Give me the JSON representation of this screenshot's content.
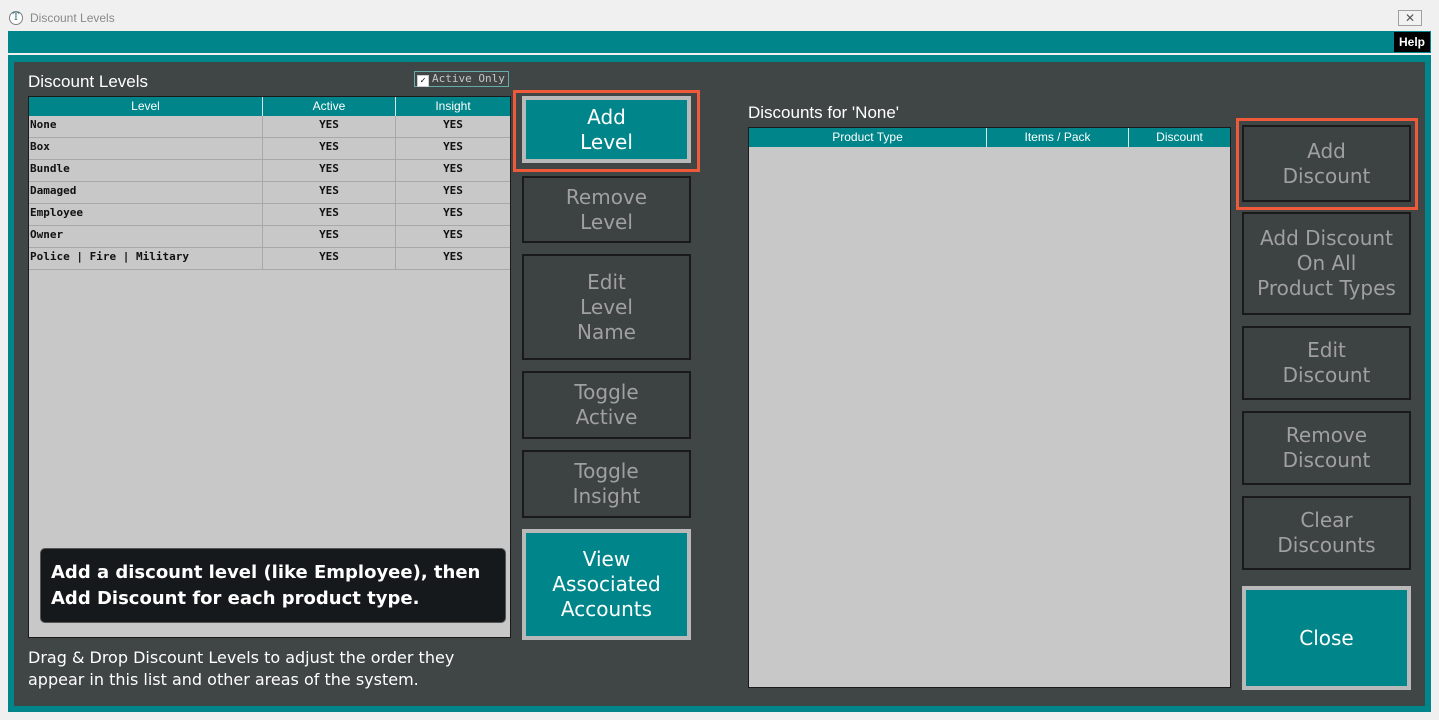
{
  "window": {
    "title": "Discount Levels",
    "close_glyph": "✕",
    "app_glyph": "T"
  },
  "menubar": {
    "help_label": "Help"
  },
  "levels": {
    "title": "Discount Levels",
    "active_only_label": "Active Only",
    "active_only_checked": true,
    "columns": [
      "Level",
      "Active",
      "Insight"
    ],
    "rows": [
      {
        "name": "None",
        "active": "YES",
        "insight": "YES"
      },
      {
        "name": "Box",
        "active": "YES",
        "insight": "YES"
      },
      {
        "name": "Bundle",
        "active": "YES",
        "insight": "YES"
      },
      {
        "name": "Damaged",
        "active": "YES",
        "insight": "YES"
      },
      {
        "name": "Employee",
        "active": "YES",
        "insight": "YES"
      },
      {
        "name": "Owner",
        "active": "YES",
        "insight": "YES"
      },
      {
        "name": "Police | Fire | Military",
        "active": "YES",
        "insight": "YES"
      }
    ]
  },
  "level_buttons": {
    "add": "Add\nLevel",
    "remove": "Remove\nLevel",
    "edit": "Edit\nLevel\nName",
    "toggle_active": "Toggle\nActive",
    "toggle_insight": "Toggle\nInsight",
    "view_accounts": "View\nAssociated\nAccounts"
  },
  "tooltip": "Add a discount level (like Employee), then Add Discount for each product type.",
  "drag_note": "Drag & Drop Discount Levels to adjust the order they appear in this list and other areas of the system.",
  "discounts": {
    "title": "Discounts for 'None'",
    "columns": [
      "Product Type",
      "Items / Pack",
      "Discount"
    ]
  },
  "discount_buttons": {
    "add": "Add\nDiscount",
    "add_all": "Add Discount\nOn All\nProduct Types",
    "edit": "Edit\nDiscount",
    "remove": "Remove\nDiscount",
    "clear": "Clear\nDiscounts",
    "close": "Close"
  },
  "colors": {
    "teal": "#00868a",
    "panel": "#404546",
    "highlight": "#ee5a3a"
  }
}
